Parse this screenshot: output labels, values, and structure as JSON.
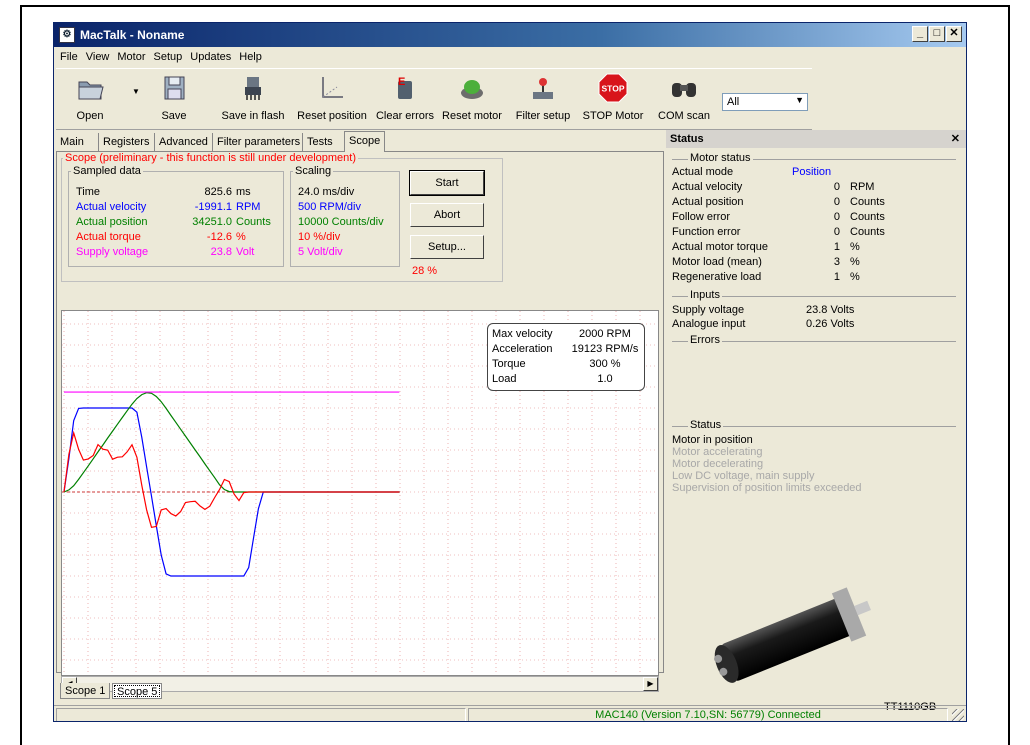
{
  "window": {
    "title": "MacTalk - Noname"
  },
  "menu": [
    "File",
    "View",
    "Motor",
    "Setup",
    "Updates",
    "Help"
  ],
  "toolbar": {
    "open": "Open",
    "save": "Save",
    "save_flash": "Save in flash",
    "reset_position": "Reset position",
    "clear_errors": "Clear errors",
    "reset_motor": "Reset motor",
    "filter_setup": "Filter setup",
    "stop_motor": "STOP Motor",
    "stop_icon_text": "STOP",
    "com_scan": "COM scan",
    "combo_value": "All"
  },
  "tabs": [
    "Main",
    "Registers",
    "Advanced",
    "Filter parameters",
    "Tests",
    "Scope"
  ],
  "scope": {
    "group_title": "Scope (preliminary - this function is still under development)",
    "sampled_title": "Sampled data",
    "scaling_title": "Scaling",
    "rows": [
      {
        "label": "Time",
        "value": "825.6",
        "unit": "ms",
        "scale": "24.0 ms/div",
        "color": "#000000"
      },
      {
        "label": "Actual velocity",
        "value": "-1991.1",
        "unit": "RPM",
        "scale": "500 RPM/div",
        "color": "#0000ff"
      },
      {
        "label": "Actual position",
        "value": "34251.0",
        "unit": "Counts",
        "scale": "10000 Counts/div",
        "color": "#008000"
      },
      {
        "label": "Actual torque",
        "value": "-12.6",
        "unit": "%",
        "scale": "10 %/div",
        "color": "#ff0000"
      },
      {
        "label": "Supply voltage",
        "value": "23.8",
        "unit": "Volt",
        "scale": "5 Volt/div",
        "color": "#ff00ff"
      }
    ],
    "start": "Start",
    "abort": "Abort",
    "setup": "Setup...",
    "percent": "28 %",
    "info": [
      {
        "label": "Max velocity",
        "value": "2000 RPM"
      },
      {
        "label": "Acceleration",
        "value": "19123 RPM/s"
      },
      {
        "label": "Torque",
        "value": "300 %"
      },
      {
        "label": "Load",
        "value": "1.0"
      }
    ],
    "scope_tabs": [
      "Scope 1",
      "Scope 5"
    ]
  },
  "status_panel": {
    "title": "Status",
    "motor_status_title": "Motor status",
    "motor_status": [
      {
        "label": "Actual mode",
        "value": "Position",
        "unit": "",
        "color": "#0000ff"
      },
      {
        "label": "Actual velocity",
        "value": "0",
        "unit": "RPM"
      },
      {
        "label": "Actual position",
        "value": "0",
        "unit": "Counts"
      },
      {
        "label": "Follow error",
        "value": "0",
        "unit": "Counts"
      },
      {
        "label": "Function error",
        "value": "0",
        "unit": "Counts"
      },
      {
        "label": "Actual motor torque",
        "value": "1",
        "unit": "%"
      },
      {
        "label": "Motor load (mean)",
        "value": "3",
        "unit": "%"
      },
      {
        "label": "Regenerative load",
        "value": "1",
        "unit": "%"
      }
    ],
    "inputs_title": "Inputs",
    "inputs": [
      {
        "label": "Supply voltage",
        "value": "23.8 Volts"
      },
      {
        "label": "Analogue input",
        "value": "0.26 Volts"
      }
    ],
    "errors_title": "Errors",
    "status_title": "Status",
    "status_items": [
      {
        "text": "Motor in position",
        "active": true
      },
      {
        "text": "Motor accelerating",
        "active": false
      },
      {
        "text": "Motor decelerating",
        "active": false
      },
      {
        "text": "Low DC voltage, main supply",
        "active": false
      },
      {
        "text": "Supervision of position limits exceeded",
        "active": false
      }
    ],
    "motor_label": "TT1110GB"
  },
  "statusbar": {
    "connection": "MAC140 (Version 7.10,SN: 56779) Connected"
  },
  "colors": {
    "velocity": "#0000ff",
    "position": "#008000",
    "torque": "#ff0000",
    "voltage": "#ff00ff",
    "grid": "#e08080"
  },
  "chart_data": {
    "type": "line",
    "x_unit": "ms",
    "x": [
      0,
      12,
      24,
      36,
      48,
      60,
      72,
      84,
      96,
      108,
      120,
      132,
      144,
      156,
      168,
      180,
      192,
      204,
      216,
      228,
      240,
      252,
      264,
      276,
      288,
      300,
      312,
      324,
      336,
      348,
      360,
      372,
      384,
      396,
      408,
      420,
      432,
      444,
      456,
      468,
      480,
      492,
      504,
      516,
      528,
      540,
      552,
      564,
      576,
      588,
      600,
      612,
      624,
      636,
      648,
      660,
      672,
      684,
      696,
      708,
      720,
      732,
      744,
      756,
      768,
      780,
      792,
      804,
      816,
      828
    ],
    "series": [
      {
        "name": "Actual velocity",
        "unit": "RPM",
        "color": "#0000ff",
        "values": [
          0,
          800,
          1700,
          1990,
          2000,
          2000,
          2000,
          2000,
          2000,
          2000,
          2000,
          2000,
          2000,
          2000,
          2000,
          1900,
          1300,
          600,
          -100,
          -800,
          -1500,
          -1950,
          -2000,
          -2000,
          -2000,
          -2000,
          -2000,
          -2000,
          -2000,
          -2000,
          -2000,
          -2000,
          -2000,
          -2000,
          -2000,
          -2000,
          -2000,
          -2000,
          -1800,
          -1100,
          -400,
          0,
          0,
          0,
          0,
          0,
          0,
          0,
          0,
          0,
          0,
          0,
          0,
          0,
          0,
          0,
          0,
          0,
          0,
          0,
          0,
          0,
          0,
          0,
          0,
          0,
          0,
          0,
          0,
          0
        ]
      },
      {
        "name": "Actual position",
        "unit": "Counts",
        "color": "#008000",
        "values": [
          0,
          1000,
          3000,
          6000,
          9200,
          12500,
          15800,
          19100,
          22400,
          25700,
          29000,
          32300,
          35500,
          38700,
          41800,
          44500,
          46400,
          47300,
          47000,
          45500,
          43000,
          39800,
          36500,
          33200,
          29900,
          26600,
          23300,
          20000,
          16700,
          13400,
          10100,
          6800,
          3500,
          1200,
          200,
          0,
          0,
          0,
          0,
          0,
          0,
          0,
          0,
          0,
          0,
          0,
          0,
          0,
          0,
          0,
          0,
          0,
          0,
          0,
          0,
          0,
          0,
          0,
          0,
          0,
          0,
          0,
          0,
          0,
          0,
          0,
          0,
          0,
          0,
          0
        ]
      },
      {
        "name": "Actual torque",
        "unit": "%",
        "color": "#ff0000",
        "values": [
          0,
          18,
          25,
          20,
          18,
          19,
          18,
          20,
          17,
          19,
          18,
          20,
          18,
          17,
          19,
          15,
          5,
          -5,
          -15,
          -18,
          -12,
          -10,
          -9,
          -8,
          -7,
          -6,
          -8,
          -7,
          -6,
          -5,
          -4,
          -3,
          -2,
          3,
          5,
          2,
          -1,
          0,
          0,
          0,
          0,
          0,
          0,
          0,
          0,
          0,
          0,
          0,
          0,
          0,
          0,
          0,
          0,
          0,
          0,
          0,
          0,
          0,
          0,
          0,
          0,
          0,
          0,
          0,
          0,
          0,
          0,
          0,
          0,
          0
        ]
      },
      {
        "name": "Supply voltage",
        "unit": "Volt",
        "color": "#ff00ff",
        "values": [
          23.8,
          23.8,
          23.8,
          23.8,
          23.8,
          23.8,
          23.8,
          23.8,
          23.8,
          23.8,
          23.8,
          23.8,
          23.8,
          23.8,
          23.8,
          23.8,
          23.8,
          23.8,
          23.8,
          23.8,
          23.8,
          23.8,
          23.8,
          23.8,
          23.8,
          23.8,
          23.8,
          23.8,
          23.8,
          23.8,
          23.8,
          23.8,
          23.8,
          23.8,
          23.8,
          23.8,
          23.8,
          23.8,
          23.8,
          23.8,
          23.8,
          23.8,
          23.8,
          23.8,
          23.8,
          23.8,
          23.8,
          23.8,
          23.8,
          23.8,
          23.8,
          23.8,
          23.8,
          23.8,
          23.8,
          23.8,
          23.8,
          23.8,
          23.8,
          23.8,
          23.8,
          23.8,
          23.8,
          23.8,
          23.8,
          23.8,
          23.8,
          23.8,
          23.8,
          23.8
        ]
      }
    ],
    "grid": true
  }
}
